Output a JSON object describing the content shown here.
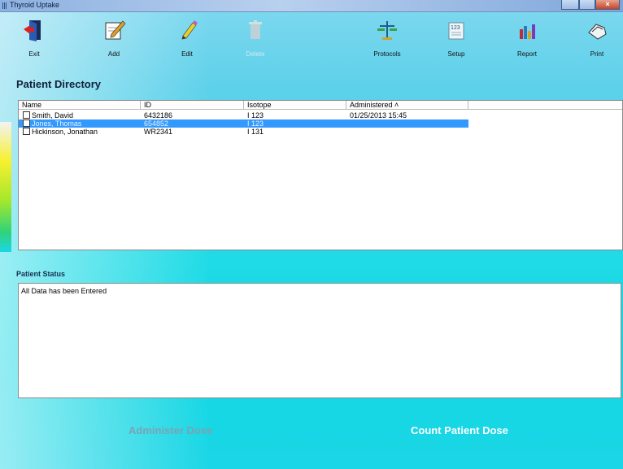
{
  "window": {
    "title": "Thyroid Uptake"
  },
  "toolbar": [
    {
      "name": "exit",
      "label": "Exit",
      "icon": "exit-door-icon",
      "enabled": true
    },
    {
      "name": "add",
      "label": "Add",
      "icon": "add-pencil-icon",
      "enabled": true
    },
    {
      "name": "edit",
      "label": "Edit",
      "icon": "edit-pencil-icon",
      "enabled": true
    },
    {
      "name": "delete",
      "label": "Delete",
      "icon": "trash-can-icon",
      "enabled": false
    },
    {
      "name": "protocols",
      "label": "Protocols",
      "icon": "protocols-scale-icon",
      "enabled": true
    },
    {
      "name": "setup",
      "label": "Setup",
      "icon": "setup-123-icon",
      "enabled": true
    },
    {
      "name": "report",
      "label": "Report",
      "icon": "report-chart-icon",
      "enabled": true
    },
    {
      "name": "print",
      "label": "Print",
      "icon": "print-hand-icon",
      "enabled": true
    }
  ],
  "directory": {
    "heading": "Patient Directory",
    "columns": [
      "Name",
      "ID",
      "Isotope",
      "Administered ˄"
    ],
    "rows": [
      {
        "name": "Smith, David",
        "id": "6432186",
        "isotope": "I 123",
        "administered": "01/25/2013 15:45",
        "selected": false
      },
      {
        "name": "Jones, Thomas",
        "id": "654852",
        "isotope": "I 123",
        "administered": "",
        "selected": true
      },
      {
        "name": "Hickinson, Jonathan",
        "id": "WR2341",
        "isotope": "I 131",
        "administered": "",
        "selected": false
      }
    ]
  },
  "status": {
    "heading": "Patient Status",
    "text": "All Data has been Entered"
  },
  "actions": {
    "administer_label": "Administer Dose",
    "count_label": "Count Patient Dose"
  },
  "colors": {
    "selection": "#3399ff",
    "background_cyan": "#1bd6e6",
    "disabled_text": "#7aa3b3"
  }
}
